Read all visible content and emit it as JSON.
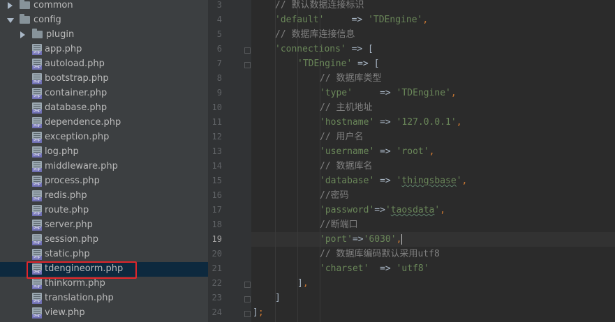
{
  "project_tree": {
    "items": [
      {
        "kind": "folder",
        "label": "common",
        "expanded": false,
        "depth": 0
      },
      {
        "kind": "folder",
        "label": "config",
        "expanded": true,
        "depth": 0
      },
      {
        "kind": "folder",
        "label": "plugin",
        "expanded": false,
        "depth": 1
      },
      {
        "kind": "file",
        "label": "app.php",
        "depth": 1
      },
      {
        "kind": "file",
        "label": "autoload.php",
        "depth": 1
      },
      {
        "kind": "file",
        "label": "bootstrap.php",
        "depth": 1
      },
      {
        "kind": "file",
        "label": "container.php",
        "depth": 1
      },
      {
        "kind": "file",
        "label": "database.php",
        "depth": 1
      },
      {
        "kind": "file",
        "label": "dependence.php",
        "depth": 1
      },
      {
        "kind": "file",
        "label": "exception.php",
        "depth": 1
      },
      {
        "kind": "file",
        "label": "log.php",
        "depth": 1
      },
      {
        "kind": "file",
        "label": "middleware.php",
        "depth": 1
      },
      {
        "kind": "file",
        "label": "process.php",
        "depth": 1
      },
      {
        "kind": "file",
        "label": "redis.php",
        "depth": 1
      },
      {
        "kind": "file",
        "label": "route.php",
        "depth": 1
      },
      {
        "kind": "file",
        "label": "server.php",
        "depth": 1
      },
      {
        "kind": "file",
        "label": "session.php",
        "depth": 1
      },
      {
        "kind": "file",
        "label": "static.php",
        "depth": 1
      },
      {
        "kind": "file",
        "label": "tdengineorm.php",
        "depth": 1,
        "selected": true
      },
      {
        "kind": "file",
        "label": "thinkorm.php",
        "depth": 1
      },
      {
        "kind": "file",
        "label": "translation.php",
        "depth": 1
      },
      {
        "kind": "file",
        "label": "view.php",
        "depth": 1
      }
    ],
    "file_icon_badge": "PHP"
  },
  "editor": {
    "current_line": 19,
    "lines": [
      {
        "n": 3,
        "indent": 1,
        "tokens": [
          [
            "comment",
            "// 默认数据连接标识"
          ]
        ]
      },
      {
        "n": 4,
        "indent": 1,
        "tokens": [
          [
            "string",
            "'default'"
          ],
          [
            "plain",
            "     => "
          ],
          [
            "string",
            "'TDEngine'"
          ],
          [
            "punct",
            ","
          ]
        ]
      },
      {
        "n": 5,
        "indent": 1,
        "tokens": [
          [
            "comment",
            "// 数据库连接信息"
          ]
        ]
      },
      {
        "n": 6,
        "indent": 1,
        "tokens": [
          [
            "string",
            "'connections'"
          ],
          [
            "plain",
            " => ["
          ]
        ]
      },
      {
        "n": 7,
        "indent": 2,
        "tokens": [
          [
            "string",
            "'TDEngine'"
          ],
          [
            "plain",
            " => ["
          ]
        ]
      },
      {
        "n": 8,
        "indent": 3,
        "tokens": [
          [
            "comment",
            "// 数据库类型"
          ]
        ]
      },
      {
        "n": 9,
        "indent": 3,
        "tokens": [
          [
            "string",
            "'type'"
          ],
          [
            "plain",
            "     => "
          ],
          [
            "string",
            "'TDEngine'"
          ],
          [
            "punct",
            ","
          ]
        ]
      },
      {
        "n": 10,
        "indent": 3,
        "tokens": [
          [
            "comment",
            "// 主机地址"
          ]
        ]
      },
      {
        "n": 11,
        "indent": 3,
        "tokens": [
          [
            "string",
            "'hostname'"
          ],
          [
            "plain",
            " => "
          ],
          [
            "string",
            "'127.0.0.1'"
          ],
          [
            "punct",
            ","
          ]
        ]
      },
      {
        "n": 12,
        "indent": 3,
        "tokens": [
          [
            "comment",
            "// 用户名"
          ]
        ]
      },
      {
        "n": 13,
        "indent": 3,
        "tokens": [
          [
            "string",
            "'username'"
          ],
          [
            "plain",
            " => "
          ],
          [
            "string",
            "'root'"
          ],
          [
            "punct",
            ","
          ]
        ]
      },
      {
        "n": 14,
        "indent": 3,
        "tokens": [
          [
            "comment",
            "// 数据库名"
          ]
        ]
      },
      {
        "n": 15,
        "indent": 3,
        "tokens": [
          [
            "string",
            "'database'"
          ],
          [
            "plain",
            " => "
          ],
          [
            "string",
            "'"
          ],
          [
            "string-spell",
            "thingsbase"
          ],
          [
            "string",
            "'"
          ],
          [
            "punct",
            ","
          ]
        ]
      },
      {
        "n": 16,
        "indent": 3,
        "tokens": [
          [
            "comment",
            "//密码"
          ]
        ]
      },
      {
        "n": 17,
        "indent": 3,
        "tokens": [
          [
            "string",
            "'password'"
          ],
          [
            "plain",
            "=>"
          ],
          [
            "string",
            "'"
          ],
          [
            "string-spell",
            "taosdata"
          ],
          [
            "string",
            "'"
          ],
          [
            "punct",
            ","
          ]
        ]
      },
      {
        "n": 18,
        "indent": 3,
        "tokens": [
          [
            "comment",
            "//断端口"
          ]
        ]
      },
      {
        "n": 19,
        "indent": 3,
        "tokens": [
          [
            "string",
            "'port'"
          ],
          [
            "plain",
            "=>"
          ],
          [
            "string",
            "'6030'"
          ],
          [
            "punct",
            ","
          ],
          [
            "caret",
            ""
          ]
        ]
      },
      {
        "n": 20,
        "indent": 3,
        "tokens": [
          [
            "comment",
            "// 数据库编码默认采用utf8"
          ]
        ]
      },
      {
        "n": 21,
        "indent": 3,
        "tokens": [
          [
            "string",
            "'charset'"
          ],
          [
            "plain",
            "  => "
          ],
          [
            "string",
            "'utf8'"
          ]
        ]
      },
      {
        "n": 22,
        "indent": 2,
        "tokens": [
          [
            "plain",
            "]"
          ],
          [
            "punct",
            ","
          ]
        ]
      },
      {
        "n": 23,
        "indent": 1,
        "tokens": [
          [
            "plain",
            "]"
          ]
        ]
      },
      {
        "n": 24,
        "indent": 0,
        "tokens": [
          [
            "plain",
            "]"
          ],
          [
            "punct",
            ";"
          ]
        ]
      }
    ],
    "fold_markers": [
      6,
      7,
      22,
      23,
      24
    ]
  },
  "colors": {
    "tree_bg": "#3c3f41",
    "editor_bg": "#2b2b2b",
    "string": "#6a8759",
    "comment": "#808080",
    "keyword_punct": "#cc7832",
    "selection_outline": "#e0262b"
  }
}
